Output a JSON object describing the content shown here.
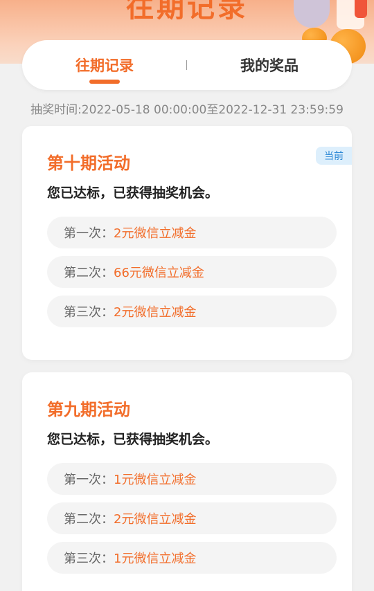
{
  "header": {
    "title": "往期记录"
  },
  "tabs": [
    {
      "label": "往期记录",
      "active": true
    },
    {
      "label": "我的奖品",
      "active": false
    }
  ],
  "draw_time": "抽奖时间:2022-05-18 00:00:00至2022-12-31 23:59:59",
  "activities": [
    {
      "title": "第十期活动",
      "badge": "当前",
      "status": "您已达标，已获得抽奖机会。",
      "prizes": [
        {
          "label": "第一次：",
          "value": "2元微信立减金"
        },
        {
          "label": "第二次：",
          "value": "66元微信立减金"
        },
        {
          "label": "第三次：",
          "value": "2元微信立减金"
        }
      ]
    },
    {
      "title": "第九期活动",
      "status": "您已达标，已获得抽奖机会。",
      "prizes": [
        {
          "label": "第一次：",
          "value": "1元微信立减金"
        },
        {
          "label": "第二次：",
          "value": "2元微信立减金"
        },
        {
          "label": "第三次：",
          "value": "1元微信立减金"
        }
      ]
    }
  ],
  "colors": {
    "accent": "#f26d2a",
    "badge_bg": "#ddeffc",
    "badge_text": "#2f8ad6",
    "page_bg": "#f1f1f1"
  }
}
